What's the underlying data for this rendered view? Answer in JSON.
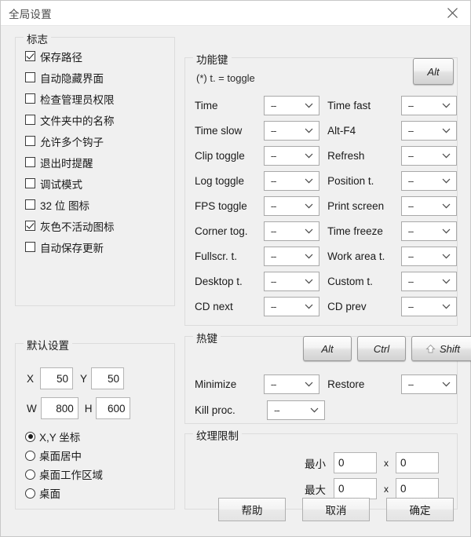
{
  "window": {
    "title": "全局设置",
    "close_icon": "close-icon"
  },
  "flags": {
    "title": "标志",
    "items": [
      {
        "label": "保存路径",
        "checked": true
      },
      {
        "label": "自动隐藏界面",
        "checked": false
      },
      {
        "label": "检查管理员权限",
        "checked": false
      },
      {
        "label": "文件夹中的名称",
        "checked": false
      },
      {
        "label": "允许多个钩子",
        "checked": false
      },
      {
        "label": "退出时提醒",
        "checked": false
      },
      {
        "label": "调试模式",
        "checked": false
      },
      {
        "label": "32 位 图标",
        "checked": false
      },
      {
        "label": "灰色不活动图标",
        "checked": true
      },
      {
        "label": "自动保存更新",
        "checked": false
      }
    ]
  },
  "defaults": {
    "title": "默认设置",
    "fields": [
      {
        "label": "X",
        "value": "50"
      },
      {
        "label": "Y",
        "value": "50"
      },
      {
        "label": "W",
        "value": "800"
      },
      {
        "label": "H",
        "value": "600"
      }
    ],
    "radios": [
      {
        "label": "X,Y 坐标",
        "selected": true
      },
      {
        "label": "桌面居中",
        "selected": false
      },
      {
        "label": "桌面工作区域",
        "selected": false
      },
      {
        "label": "桌面",
        "selected": false
      }
    ]
  },
  "function_keys": {
    "title": "功能键",
    "hint": "(*) t.  = toggle",
    "modifier": {
      "label": "Alt",
      "icon": "none"
    },
    "rows": [
      {
        "left_label": "Time",
        "left_value": "--",
        "right_label": "Time fast",
        "right_value": "--"
      },
      {
        "left_label": "Time slow",
        "left_value": "--",
        "right_label": "Alt-F4",
        "right_value": "--"
      },
      {
        "left_label": "Clip toggle",
        "left_value": "--",
        "right_label": "Refresh",
        "right_value": "--"
      },
      {
        "left_label": "Log toggle",
        "left_value": "--",
        "right_label": "Position t.",
        "right_value": "--"
      },
      {
        "left_label": "FPS toggle",
        "left_value": "--",
        "right_label": "Print screen",
        "right_value": "--"
      },
      {
        "left_label": "Corner tog.",
        "left_value": "--",
        "right_label": "Time freeze",
        "right_value": "--"
      },
      {
        "left_label": "Fullscr. t.",
        "left_value": "--",
        "right_label": "Work area t.",
        "right_value": "--"
      },
      {
        "left_label": "Desktop t.",
        "left_value": "--",
        "right_label": "Custom t.",
        "right_value": "--"
      },
      {
        "left_label": "CD next",
        "left_value": "--",
        "right_label": "CD prev",
        "right_value": "--"
      }
    ]
  },
  "hotkeys": {
    "title": "热键",
    "modifiers": [
      {
        "label": "Alt",
        "icon": "none"
      },
      {
        "label": "Ctrl",
        "icon": "none"
      },
      {
        "label": "Shift",
        "icon": "shift-arrow-icon"
      }
    ],
    "rows": [
      {
        "left_label": "Minimize",
        "left_value": "--",
        "right_label": "Restore",
        "right_value": "--"
      },
      {
        "left_label": "Kill proc.",
        "left_value": "--",
        "right_label": "",
        "right_value": ""
      }
    ]
  },
  "texture_limits": {
    "title": "纹理限制",
    "rows": [
      {
        "label": "最小",
        "w": "0",
        "sep": "x",
        "h": "0"
      },
      {
        "label": "最大",
        "w": "0",
        "sep": "x",
        "h": "0"
      }
    ]
  },
  "footer": {
    "help": "帮助",
    "cancel": "取消",
    "ok": "确定"
  }
}
